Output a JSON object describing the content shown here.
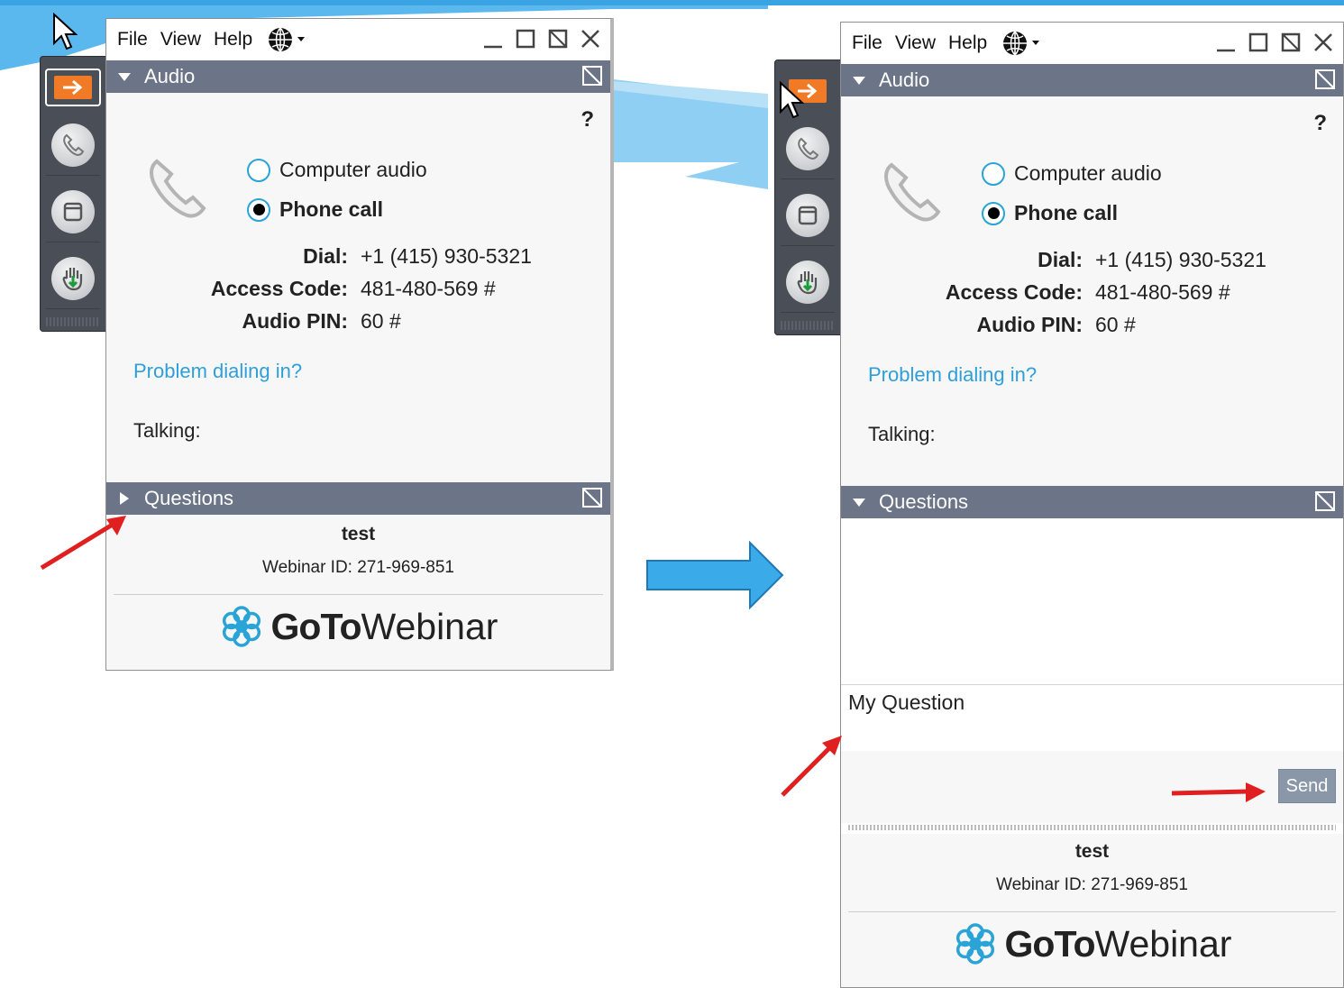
{
  "colors": {
    "accent_blue": "#2aa3d6",
    "header_gray": "#6b7587",
    "orange": "#f07a26",
    "annotation_red": "#e02020",
    "big_arrow_blue": "#3aabe8"
  },
  "before": {
    "menu": {
      "file": "File",
      "view": "View",
      "help": "Help"
    },
    "audio_header": "Audio",
    "help_mark": "?",
    "computer_audio": "Computer audio",
    "phone_call": "Phone call",
    "dial_label": "Dial:",
    "dial_value": "+1 (415) 930-5321",
    "access_label": "Access Code:",
    "access_value": "481-480-569 #",
    "pin_label": "Audio PIN:",
    "pin_value": "60 #",
    "problem_link": "Problem dialing in?",
    "talking": "Talking:",
    "questions_header": "Questions",
    "questions_expanded": false,
    "webinar_title": "test",
    "webinar_id": "Webinar ID: 271-969-851",
    "logo_bold": "GoTo",
    "logo_thin": "Webinar"
  },
  "after": {
    "menu": {
      "file": "File",
      "view": "View",
      "help": "Help"
    },
    "audio_header": "Audio",
    "help_mark": "?",
    "computer_audio": "Computer audio",
    "phone_call": "Phone call",
    "dial_label": "Dial:",
    "dial_value": "+1 (415) 930-5321",
    "access_label": "Access Code:",
    "access_value": "481-480-569 #",
    "pin_label": "Audio PIN:",
    "pin_value": "60 #",
    "problem_link": "Problem dialing in?",
    "talking": "Talking:",
    "questions_header": "Questions",
    "questions_expanded": true,
    "question_input": "My Question",
    "send_label": "Send",
    "webinar_title": "test",
    "webinar_id": "Webinar ID: 271-969-851",
    "logo_bold": "GoTo",
    "logo_thin": "Webinar"
  },
  "selected_audio": "phone_call"
}
